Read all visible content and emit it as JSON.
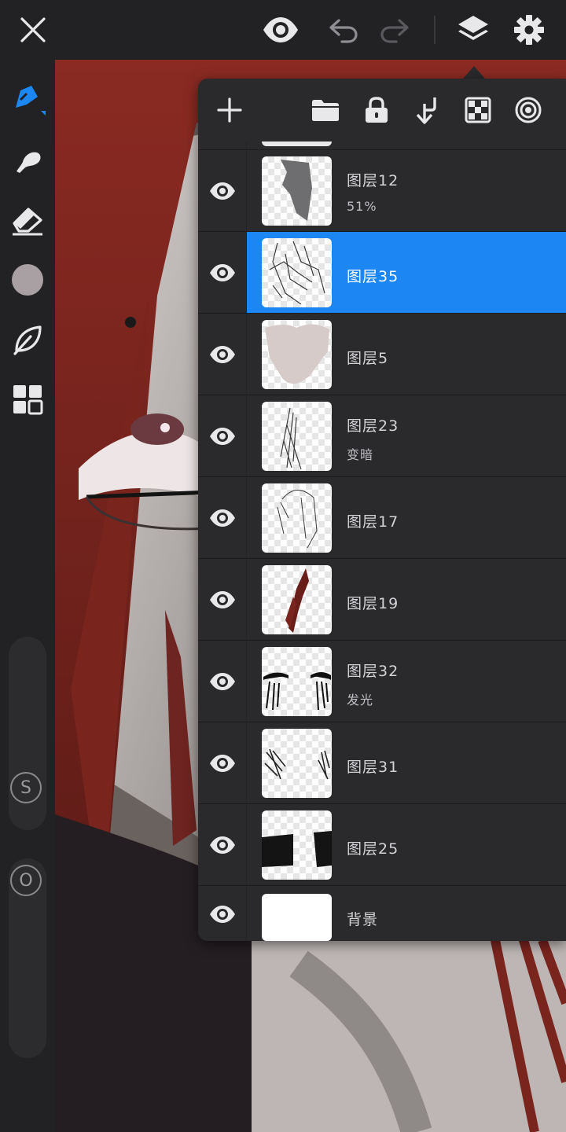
{
  "toolbar": {
    "close_icon": "close-icon",
    "visibility_icon": "eye-icon",
    "undo_icon": "undo-icon",
    "redo_icon": "redo-icon",
    "layers_icon": "layers-icon",
    "settings_icon": "gear-icon"
  },
  "sidebar": {
    "tools": [
      "pen-tool-icon",
      "smudge-tool-icon",
      "eraser-tool-icon",
      "color-swatch",
      "leaf-brush-icon",
      "grid-menu-icon"
    ],
    "size_label": "S",
    "opacity_label": "O",
    "accent": "#1c86f2",
    "swatch_color": "#a8a0a2"
  },
  "layer_panel": {
    "tools": [
      "add-layer-icon",
      "folder-icon",
      "lock-icon",
      "merge-down-icon",
      "transparency-icon",
      "blend-mode-icon"
    ],
    "layers": [
      {
        "name": "图层12",
        "sub": "51%",
        "visible": true,
        "selected": false
      },
      {
        "name": "图层35",
        "sub": "",
        "visible": true,
        "selected": true
      },
      {
        "name": "图层5",
        "sub": "",
        "visible": true,
        "selected": false
      },
      {
        "name": "图层23",
        "sub": "变暗",
        "visible": true,
        "selected": false
      },
      {
        "name": "图层17",
        "sub": "",
        "visible": true,
        "selected": false
      },
      {
        "name": "图层19",
        "sub": "",
        "visible": true,
        "selected": false
      },
      {
        "name": "图层32",
        "sub": "发光",
        "visible": true,
        "selected": false
      },
      {
        "name": "图层31",
        "sub": "",
        "visible": true,
        "selected": false
      },
      {
        "name": "图层25",
        "sub": "",
        "visible": true,
        "selected": false
      },
      {
        "name": "背景",
        "sub": "",
        "visible": true,
        "selected": false
      }
    ]
  }
}
